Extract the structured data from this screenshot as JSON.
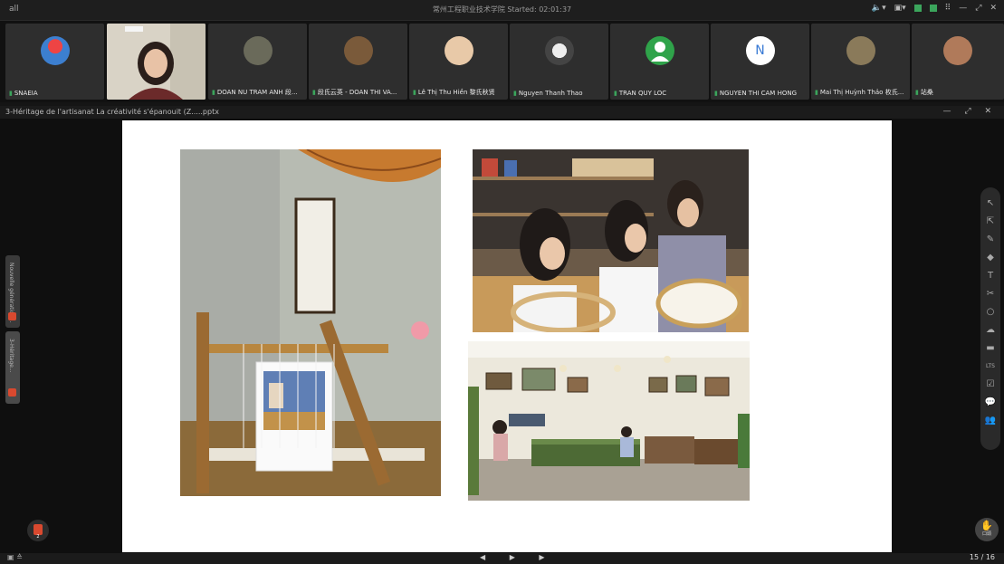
{
  "meeting": {
    "signal": "all",
    "title": "常州工程职业技术学院",
    "started": "Started: 02:01:37"
  },
  "participants": [
    {
      "name": "SNAEIA",
      "avatar": "hot-air-balloon-icon",
      "color": "#3c7fd0"
    },
    {
      "name": "",
      "avatar": "webcam-video",
      "color": "#c9c2b4"
    },
    {
      "name": "DOAN NU TRAM ANH 段...",
      "avatar": "photo-avatar",
      "color": "#6a6a5a"
    },
    {
      "name": "段氏云英 - DOAN THI VA...",
      "avatar": "photo-avatar",
      "color": "#7a5a3a"
    },
    {
      "name": "Lê Thị Thu Hiền 黎氏秋贤",
      "avatar": "photo-avatar",
      "color": "#e8c9a8"
    },
    {
      "name": "Nguyen Thanh Thao",
      "avatar": "photo-avatar",
      "color": "#555"
    },
    {
      "name": "TRAN QUY LOC",
      "avatar": "person-icon",
      "color": "#2fa34a"
    },
    {
      "name": "NGUYEN THI CAM HONG",
      "avatar": "N",
      "color": "#ffffff"
    },
    {
      "name": "Mai Thị Huỳnh Thảo 枚氏...",
      "avatar": "photo-avatar",
      "color": "#8a7a5a"
    },
    {
      "name": "站桑",
      "avatar": "photo-avatar",
      "color": "#b07a5a"
    }
  ],
  "share": {
    "filename": "3-Héritage de l'artisanat La créativité s'épanouit (Z.....pptx",
    "controls": "— ⤢ ✕"
  },
  "left_tabs": [
    {
      "label": "Nouvelle génération..."
    },
    {
      "label": "3-Héritage..."
    }
  ],
  "sidebar": {
    "ppt_count": "2",
    "hand_label": "口頭"
  },
  "tools": [
    "↖",
    "⇱",
    "✎",
    "◆",
    "T",
    "✂",
    "○",
    "☁",
    "▬",
    "LTS",
    "☑",
    "💬",
    "👥"
  ],
  "footer": {
    "nav": "◀ ▶ ▶",
    "page": "15 / 16"
  }
}
